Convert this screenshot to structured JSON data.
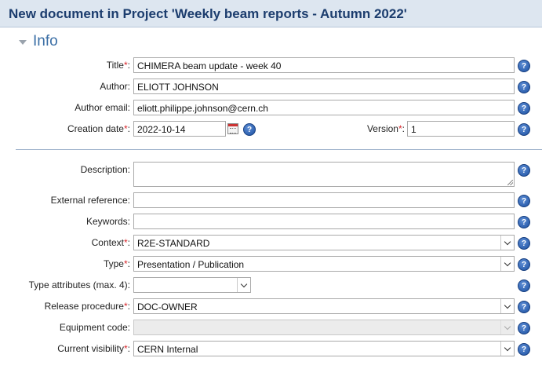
{
  "window": {
    "title": "New document in Project 'Weekly beam reports - Autumn 2022'"
  },
  "section": {
    "title": "Info",
    "collapse_icon": "triangle-down-icon"
  },
  "help_icon": "question-mark-icon",
  "help_glyph": "?",
  "required_marker": "*",
  "colon": ":",
  "fields": {
    "title": {
      "label": "Title",
      "required": true,
      "value": "CHIMERA beam update - week 40"
    },
    "author": {
      "label": "Author",
      "required": false,
      "value": "ELIOTT JOHNSON"
    },
    "author_email": {
      "label": "Author email",
      "required": false,
      "value": "eliott.philippe.johnson@cern.ch"
    },
    "creation_date": {
      "label": "Creation date",
      "required": true,
      "value": "2022-10-14",
      "calendar_icon": "calendar-icon"
    },
    "version": {
      "label": "Version",
      "required": true,
      "value": "1"
    },
    "description": {
      "label": "Description",
      "required": false,
      "value": ""
    },
    "external_reference": {
      "label": "External reference",
      "required": false,
      "value": ""
    },
    "keywords": {
      "label": "Keywords",
      "required": false,
      "value": ""
    },
    "context": {
      "label": "Context",
      "required": true,
      "value": "R2E-STANDARD"
    },
    "type": {
      "label": "Type",
      "required": true,
      "value": "Presentation / Publication"
    },
    "type_attributes": {
      "label": "Type attributes (max. 4)",
      "required": false,
      "value": ""
    },
    "release_procedure": {
      "label": "Release procedure",
      "required": true,
      "value": "DOC-OWNER"
    },
    "equipment_code": {
      "label": "Equipment code",
      "required": false,
      "value": "",
      "disabled": true
    },
    "current_visibility": {
      "label": "Current visibility",
      "required": true,
      "value": "CERN Internal"
    }
  },
  "colors": {
    "title_bar_bg": "#dde6f0",
    "title_text": "#1c3d6e",
    "section_title": "#3a6ea5",
    "required_marker": "#d9262b",
    "help_icon": "#1b4fa0"
  }
}
